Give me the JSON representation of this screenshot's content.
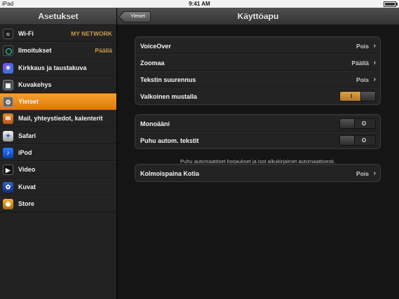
{
  "status_bar": {
    "device": "iPad",
    "time": "9:41 AM"
  },
  "sidebar": {
    "title": "Asetukset",
    "items": [
      {
        "label": "Wi-Fi",
        "value": "MY NETWORK",
        "icon": "wifi-icon"
      },
      {
        "label": "Ilmoitukset",
        "value": "Päällä",
        "icon": "notifications-icon"
      },
      {
        "label": "Kirkkaus ja taustakuva",
        "value": "",
        "icon": "brightness-icon"
      },
      {
        "label": "Kuvakehys",
        "value": "",
        "icon": "picture-frame-icon"
      },
      {
        "label": "Yleiset",
        "value": "",
        "icon": "gear-icon"
      },
      {
        "label": "Mail, yhteystiedot, kalenterit",
        "value": "",
        "icon": "mail-icon"
      },
      {
        "label": "Safari",
        "value": "",
        "icon": "compass-icon"
      },
      {
        "label": "iPod",
        "value": "",
        "icon": "music-icon"
      },
      {
        "label": "Video",
        "value": "",
        "icon": "video-icon"
      },
      {
        "label": "Kuvat",
        "value": "",
        "icon": "photos-icon"
      },
      {
        "label": "Store",
        "value": "",
        "icon": "store-icon"
      }
    ],
    "active_index": 4
  },
  "main": {
    "back_label": "Yleiset",
    "title": "Käyttöapu",
    "group1": [
      {
        "label": "VoiceOver",
        "value": "Pois"
      },
      {
        "label": "Zoomaa",
        "value": "Päällä"
      },
      {
        "label": "Tekstin suurennus",
        "value": "Pois"
      },
      {
        "label": "Valkoinen mustalla",
        "toggle": "I"
      }
    ],
    "group2": [
      {
        "label": "Monoääni",
        "toggle": "O"
      },
      {
        "label": "Puhu autom. tekstit",
        "toggle": "O"
      }
    ],
    "note": "Puhu automaattiset korjaukset ja isot alkukirjaimet automaattisesti.",
    "group3": [
      {
        "label": "Kolmoispaina Kotia",
        "value": "Pois"
      }
    ]
  },
  "colors": {
    "accent": "#ef8f1e",
    "toggle_on": "#c98b38"
  }
}
